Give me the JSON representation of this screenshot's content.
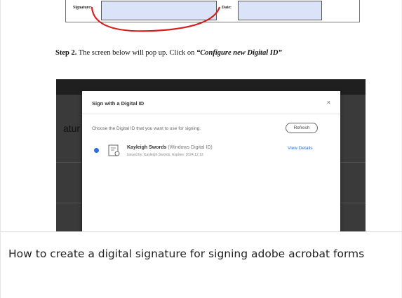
{
  "form": {
    "signature_label": "Signature:",
    "date_label": "Date:"
  },
  "step": {
    "number": "Step 2.",
    "text": "The screen below will pop up. Click on",
    "emphasis": "“Configure new Digital ID”"
  },
  "screen": {
    "background_text": "atur"
  },
  "dialog": {
    "title": "Sign with a Digital ID",
    "close_glyph": "×",
    "prompt": "Choose the Digital ID that you want to use for signing:",
    "refresh_label": "Refresh",
    "id_name": "Kayleigh Swords",
    "id_type": "(Windows Digital ID)",
    "id_issued": "Issued by: Kayleigh Swords, Expires: 2024.12.13",
    "view_details_label": "View Details"
  },
  "caption": "How to create a digital signature for signing adobe acrobat forms",
  "colors": {
    "signature_field": "#dbe3f8",
    "annotation_red": "#d62020",
    "link_blue": "#2a6fdb",
    "dark_bg": "#2b2b2b"
  },
  "icons": [
    "certificate-icon",
    "close-icon"
  ]
}
